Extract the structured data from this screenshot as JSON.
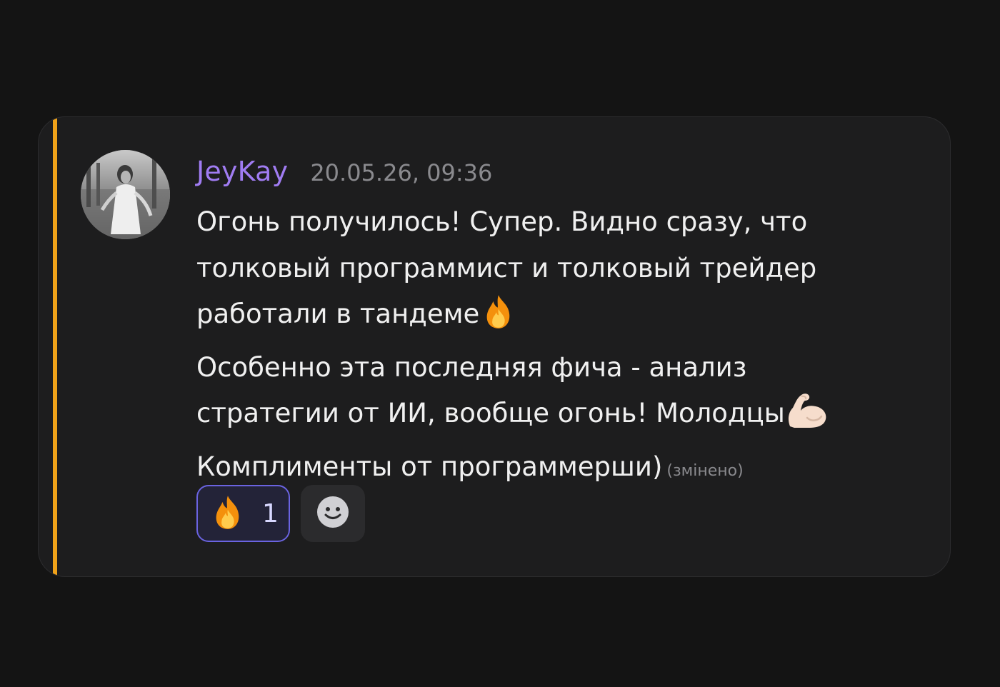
{
  "message": {
    "author": "JeyKay",
    "timestamp": "20.05.26, 09:36",
    "lines": [
      "Огонь получилось! Супер. Видно сразу, что",
      "толковый программист и толковый трейдер",
      "работали в тандеме",
      "Особенно эта последняя фича - анализ",
      "стратегии от ИИ, вообще огонь! Молодцы",
      "Комплименты от программерши)"
    ],
    "edited_label": "(змінено)",
    "inline_emojis": [
      "fire-icon",
      "flexed-biceps-icon"
    ]
  },
  "reactions": [
    {
      "emoji": "fire-icon",
      "count": "1",
      "selected": true
    }
  ],
  "add_reaction_icon": "smiley-icon",
  "colors": {
    "background": "#141414",
    "card": "#1d1d1e",
    "accent_bar": "#f0a219",
    "author": "#a07cf2",
    "reaction_border": "#6a63e0"
  }
}
